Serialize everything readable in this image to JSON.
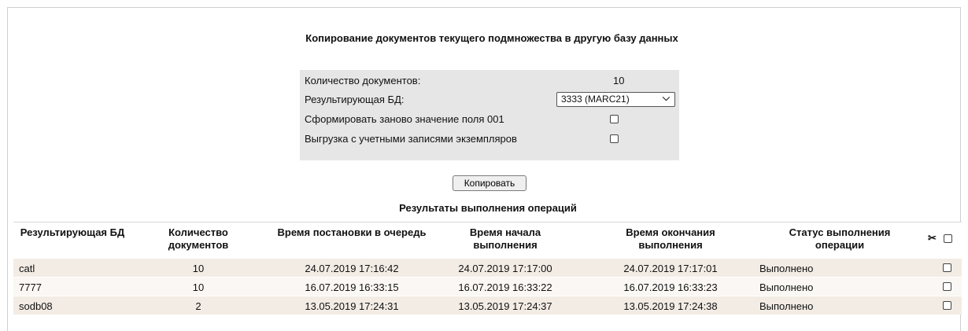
{
  "dialog": {
    "title": "Копирование документов текущего подмножества в другую базу данных",
    "fields": {
      "doc_count_label": "Количество документов:",
      "doc_count_value": "10",
      "target_db_label": "Результирующая БД:",
      "target_db_selected": "3333 (MARC21)",
      "regen_field_label": "Сформировать заново значение поля 001",
      "regen_field_checked": false,
      "with_items_label": "Выгрузка с учетными записями экземпляров",
      "with_items_checked": false
    },
    "copy_button": "Копировать"
  },
  "results": {
    "title": "Результаты выполнения операций",
    "columns": [
      "Результирующая БД",
      "Количество документов",
      "Время постановки в очередь",
      "Время начала выполнения",
      "Время окончания выполнения",
      "Статус выполнения операции"
    ],
    "select_all_icon": "scissors-icon",
    "rows": [
      {
        "db": "catl",
        "count": "10",
        "queued": "24.07.2019 17:16:42",
        "started": "24.07.2019 17:17:00",
        "finished": "24.07.2019 17:17:01",
        "status": "Выполнено"
      },
      {
        "db": "7777",
        "count": "10",
        "queued": "16.07.2019 16:33:15",
        "started": "16.07.2019 16:33:22",
        "finished": "16.07.2019 16:33:23",
        "status": "Выполнено"
      },
      {
        "db": "sodb08",
        "count": "2",
        "queued": "13.05.2019 17:24:31",
        "started": "13.05.2019 17:24:37",
        "finished": "13.05.2019 17:24:38",
        "status": "Выполнено"
      }
    ]
  }
}
